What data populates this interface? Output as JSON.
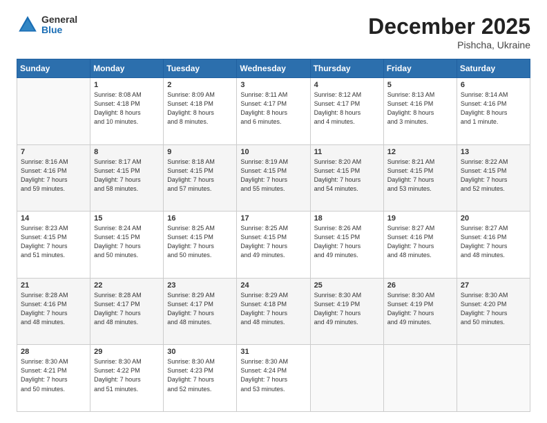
{
  "header": {
    "logo_general": "General",
    "logo_blue": "Blue",
    "month_title": "December 2025",
    "location": "Pishcha, Ukraine"
  },
  "weekdays": [
    "Sunday",
    "Monday",
    "Tuesday",
    "Wednesday",
    "Thursday",
    "Friday",
    "Saturday"
  ],
  "weeks": [
    [
      {
        "day": "",
        "info": ""
      },
      {
        "day": "1",
        "info": "Sunrise: 8:08 AM\nSunset: 4:18 PM\nDaylight: 8 hours\nand 10 minutes."
      },
      {
        "day": "2",
        "info": "Sunrise: 8:09 AM\nSunset: 4:18 PM\nDaylight: 8 hours\nand 8 minutes."
      },
      {
        "day": "3",
        "info": "Sunrise: 8:11 AM\nSunset: 4:17 PM\nDaylight: 8 hours\nand 6 minutes."
      },
      {
        "day": "4",
        "info": "Sunrise: 8:12 AM\nSunset: 4:17 PM\nDaylight: 8 hours\nand 4 minutes."
      },
      {
        "day": "5",
        "info": "Sunrise: 8:13 AM\nSunset: 4:16 PM\nDaylight: 8 hours\nand 3 minutes."
      },
      {
        "day": "6",
        "info": "Sunrise: 8:14 AM\nSunset: 4:16 PM\nDaylight: 8 hours\nand 1 minute."
      }
    ],
    [
      {
        "day": "7",
        "info": "Sunrise: 8:16 AM\nSunset: 4:16 PM\nDaylight: 7 hours\nand 59 minutes."
      },
      {
        "day": "8",
        "info": "Sunrise: 8:17 AM\nSunset: 4:15 PM\nDaylight: 7 hours\nand 58 minutes."
      },
      {
        "day": "9",
        "info": "Sunrise: 8:18 AM\nSunset: 4:15 PM\nDaylight: 7 hours\nand 57 minutes."
      },
      {
        "day": "10",
        "info": "Sunrise: 8:19 AM\nSunset: 4:15 PM\nDaylight: 7 hours\nand 55 minutes."
      },
      {
        "day": "11",
        "info": "Sunrise: 8:20 AM\nSunset: 4:15 PM\nDaylight: 7 hours\nand 54 minutes."
      },
      {
        "day": "12",
        "info": "Sunrise: 8:21 AM\nSunset: 4:15 PM\nDaylight: 7 hours\nand 53 minutes."
      },
      {
        "day": "13",
        "info": "Sunrise: 8:22 AM\nSunset: 4:15 PM\nDaylight: 7 hours\nand 52 minutes."
      }
    ],
    [
      {
        "day": "14",
        "info": "Sunrise: 8:23 AM\nSunset: 4:15 PM\nDaylight: 7 hours\nand 51 minutes."
      },
      {
        "day": "15",
        "info": "Sunrise: 8:24 AM\nSunset: 4:15 PM\nDaylight: 7 hours\nand 50 minutes."
      },
      {
        "day": "16",
        "info": "Sunrise: 8:25 AM\nSunset: 4:15 PM\nDaylight: 7 hours\nand 50 minutes."
      },
      {
        "day": "17",
        "info": "Sunrise: 8:25 AM\nSunset: 4:15 PM\nDaylight: 7 hours\nand 49 minutes."
      },
      {
        "day": "18",
        "info": "Sunrise: 8:26 AM\nSunset: 4:15 PM\nDaylight: 7 hours\nand 49 minutes."
      },
      {
        "day": "19",
        "info": "Sunrise: 8:27 AM\nSunset: 4:16 PM\nDaylight: 7 hours\nand 48 minutes."
      },
      {
        "day": "20",
        "info": "Sunrise: 8:27 AM\nSunset: 4:16 PM\nDaylight: 7 hours\nand 48 minutes."
      }
    ],
    [
      {
        "day": "21",
        "info": "Sunrise: 8:28 AM\nSunset: 4:16 PM\nDaylight: 7 hours\nand 48 minutes."
      },
      {
        "day": "22",
        "info": "Sunrise: 8:28 AM\nSunset: 4:17 PM\nDaylight: 7 hours\nand 48 minutes."
      },
      {
        "day": "23",
        "info": "Sunrise: 8:29 AM\nSunset: 4:17 PM\nDaylight: 7 hours\nand 48 minutes."
      },
      {
        "day": "24",
        "info": "Sunrise: 8:29 AM\nSunset: 4:18 PM\nDaylight: 7 hours\nand 48 minutes."
      },
      {
        "day": "25",
        "info": "Sunrise: 8:30 AM\nSunset: 4:19 PM\nDaylight: 7 hours\nand 49 minutes."
      },
      {
        "day": "26",
        "info": "Sunrise: 8:30 AM\nSunset: 4:19 PM\nDaylight: 7 hours\nand 49 minutes."
      },
      {
        "day": "27",
        "info": "Sunrise: 8:30 AM\nSunset: 4:20 PM\nDaylight: 7 hours\nand 50 minutes."
      }
    ],
    [
      {
        "day": "28",
        "info": "Sunrise: 8:30 AM\nSunset: 4:21 PM\nDaylight: 7 hours\nand 50 minutes."
      },
      {
        "day": "29",
        "info": "Sunrise: 8:30 AM\nSunset: 4:22 PM\nDaylight: 7 hours\nand 51 minutes."
      },
      {
        "day": "30",
        "info": "Sunrise: 8:30 AM\nSunset: 4:23 PM\nDaylight: 7 hours\nand 52 minutes."
      },
      {
        "day": "31",
        "info": "Sunrise: 8:30 AM\nSunset: 4:24 PM\nDaylight: 7 hours\nand 53 minutes."
      },
      {
        "day": "",
        "info": ""
      },
      {
        "day": "",
        "info": ""
      },
      {
        "day": "",
        "info": ""
      }
    ]
  ]
}
